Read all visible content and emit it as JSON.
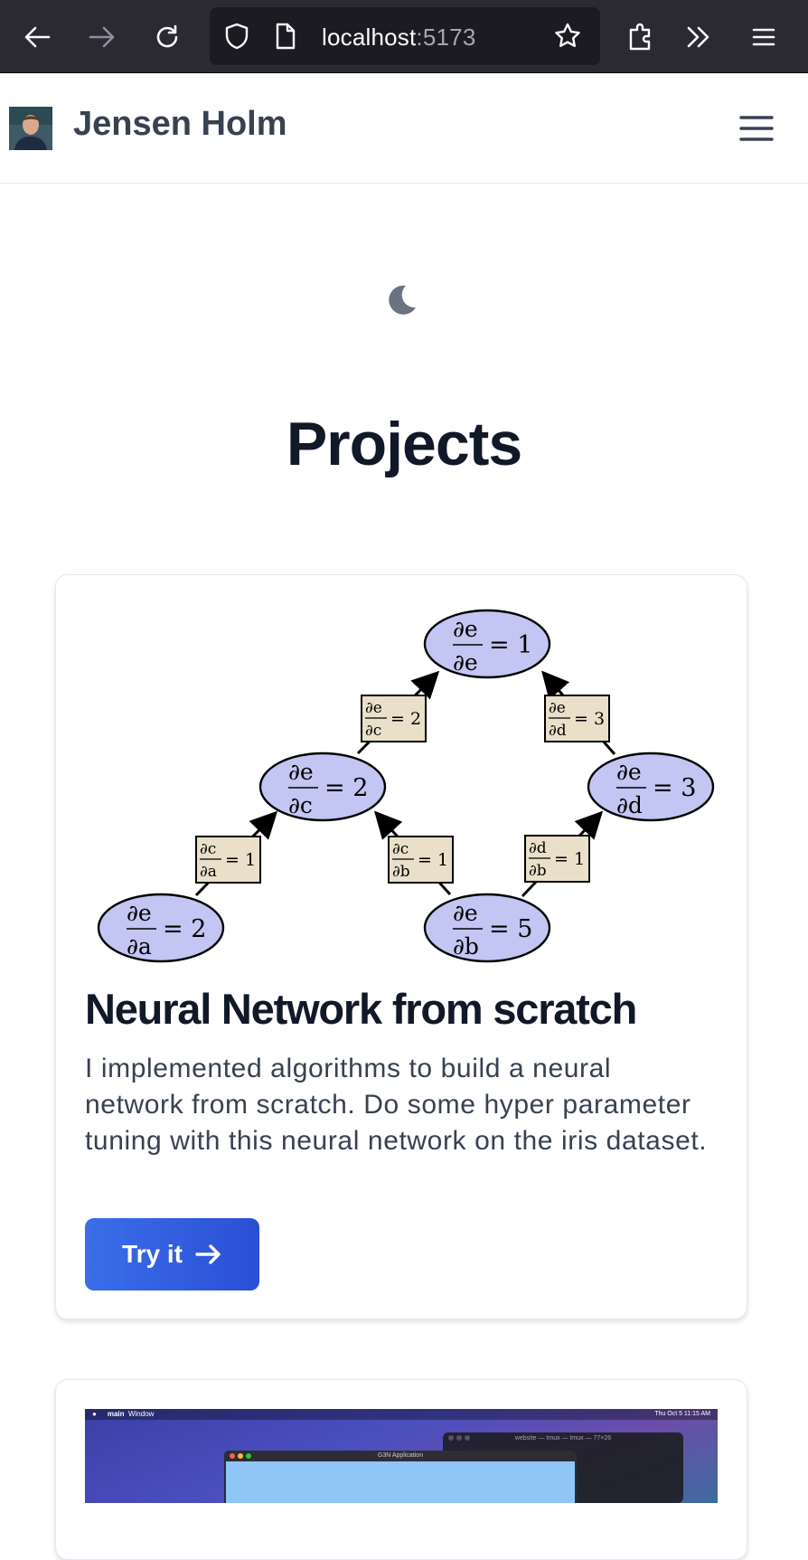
{
  "browser": {
    "url_host": "localhost",
    "url_port": ":5173"
  },
  "navbar": {
    "site_name": "Jensen Holm"
  },
  "page": {
    "title": "Projects"
  },
  "projects": [
    {
      "title": "Neural Network from scratch",
      "description": "I implemented algorithms to build a neural network from scratch. Do some hyper parameter tuning with this neural network on the iris dataset.",
      "button_label": "Try it",
      "graph": {
        "nodes": [
          {
            "id": "e",
            "num": "∂e",
            "den": "∂e",
            "value": "= 1"
          },
          {
            "id": "c",
            "num": "∂e",
            "den": "∂c",
            "value": "= 2"
          },
          {
            "id": "d",
            "num": "∂e",
            "den": "∂d",
            "value": "= 3"
          },
          {
            "id": "a",
            "num": "∂e",
            "den": "∂a",
            "value": "= 2"
          },
          {
            "id": "b",
            "num": "∂e",
            "den": "∂b",
            "value": "= 5"
          }
        ],
        "edges": [
          {
            "num": "∂e",
            "den": "∂c",
            "value": "= 2"
          },
          {
            "num": "∂e",
            "den": "∂d",
            "value": "= 3"
          },
          {
            "num": "∂c",
            "den": "∂a",
            "value": "= 1"
          },
          {
            "num": "∂c",
            "den": "∂b",
            "value": "= 1"
          },
          {
            "num": "∂d",
            "den": "∂b",
            "value": "= 1"
          }
        ]
      }
    },
    {
      "screenshot": {
        "menu_app": "main",
        "menu_window": "Window",
        "clock": "Thu Oct 5  11:15 AM",
        "terminal_title": "website — tmux — tmux — 77×26",
        "app_title": "G3N Application"
      }
    }
  ]
}
